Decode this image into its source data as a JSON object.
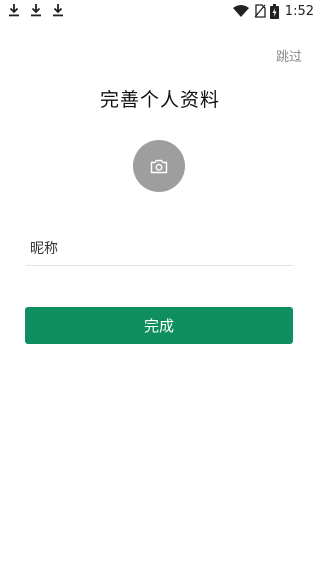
{
  "status_bar": {
    "time": "1:52",
    "icons": [
      "download-icon",
      "download-icon",
      "download-icon",
      "wifi-icon",
      "no-sim-icon",
      "battery-charging-icon"
    ]
  },
  "header": {
    "skip_label": "跳过"
  },
  "main": {
    "title": "完善个人资料",
    "avatar_icon": "camera-icon",
    "nickname_label": "昵称",
    "nickname_placeholder": "",
    "done_label": "完成"
  },
  "colors": {
    "accent": "#0f8f5f",
    "avatar_bg": "#9e9e9e",
    "skip_text": "#8a8a8a"
  }
}
